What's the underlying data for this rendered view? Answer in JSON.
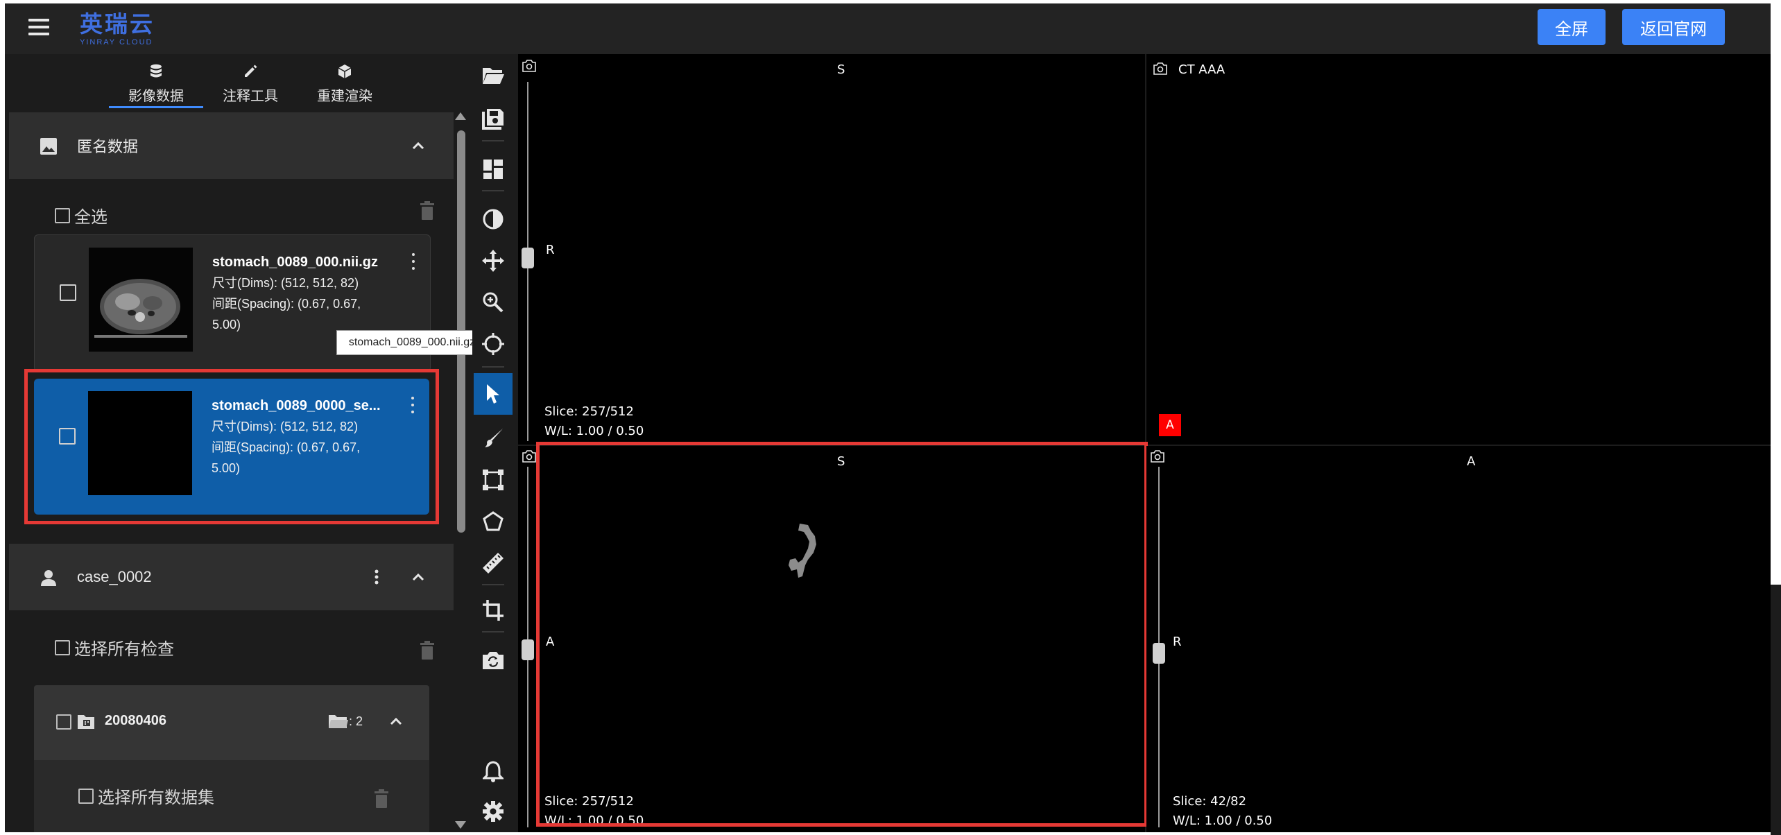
{
  "app": {
    "logo_cn": "英瑞云",
    "logo_en": "YINRAY CLOUD",
    "menu_icon": "menu-icon"
  },
  "header": {
    "fullscreen_label": "全屏",
    "back_label": "返回官网",
    "button_color": "#3b82f6"
  },
  "left_tabs": [
    {
      "label": "影像数据",
      "icon": "database-icon",
      "active": true
    },
    {
      "label": "注释工具",
      "icon": "pencil-icon",
      "active": false
    },
    {
      "label": "重建渲染",
      "icon": "cube-icon",
      "active": false
    }
  ],
  "anon_section": {
    "title": "匿名数据",
    "icon": "image-icon",
    "select_all_label": "全选"
  },
  "files": [
    {
      "title": "stomach_0089_000.nii.gz",
      "dims": "尺寸(Dims): (512, 512, 82)",
      "spacing_1": "间距(Spacing): (0.67, 0.67,",
      "spacing_2": "5.00)",
      "selected": false
    },
    {
      "title": "stomach_0089_0000_se...",
      "dims": "尺寸(Dims): (512, 512, 82)",
      "spacing_1": "间距(Spacing): (0.67, 0.67,",
      "spacing_2": "5.00)",
      "selected": true
    }
  ],
  "tooltip": "stomach_0089_000.nii.gz",
  "case_section": {
    "title": "case_0002",
    "icon": "person-icon",
    "select_all_studies": "选择所有检查",
    "study_date": "20080406",
    "study_count": ": 2",
    "select_all_datasets": "选择所有数据集"
  },
  "toolbar": [
    "folder-open-icon",
    "save-icon",
    "layout-icon",
    "contrast-icon",
    "move-icon",
    "zoom-icon",
    "crosshair-icon",
    "pointer-icon",
    "brush-icon",
    "bounding-box-icon",
    "polygon-icon",
    "ruler-icon",
    "crop-icon",
    "camera-switch-icon",
    "bell-icon",
    "gear-icon"
  ],
  "viewports": {
    "top_left": {
      "orient_top": "S",
      "orient_left": "R",
      "slice": "Slice: 257/512",
      "wl": "W/L: 1.00 / 0.50"
    },
    "top_right": {
      "label": "CT AAA",
      "badge": "A"
    },
    "bottom_left": {
      "orient_top": "S",
      "orient_left": "A",
      "slice": "Slice: 257/512",
      "wl": "W/L: 1.00 / 0.50"
    },
    "bottom_right": {
      "orient_top": "A",
      "orient_left": "R",
      "slice": "Slice: 42/82",
      "wl": "W/L: 1.00 / 0.50"
    }
  },
  "colors": {
    "selected_card": "#0f5ea8",
    "highlight": "#e53935",
    "badge": "#ff0000"
  }
}
